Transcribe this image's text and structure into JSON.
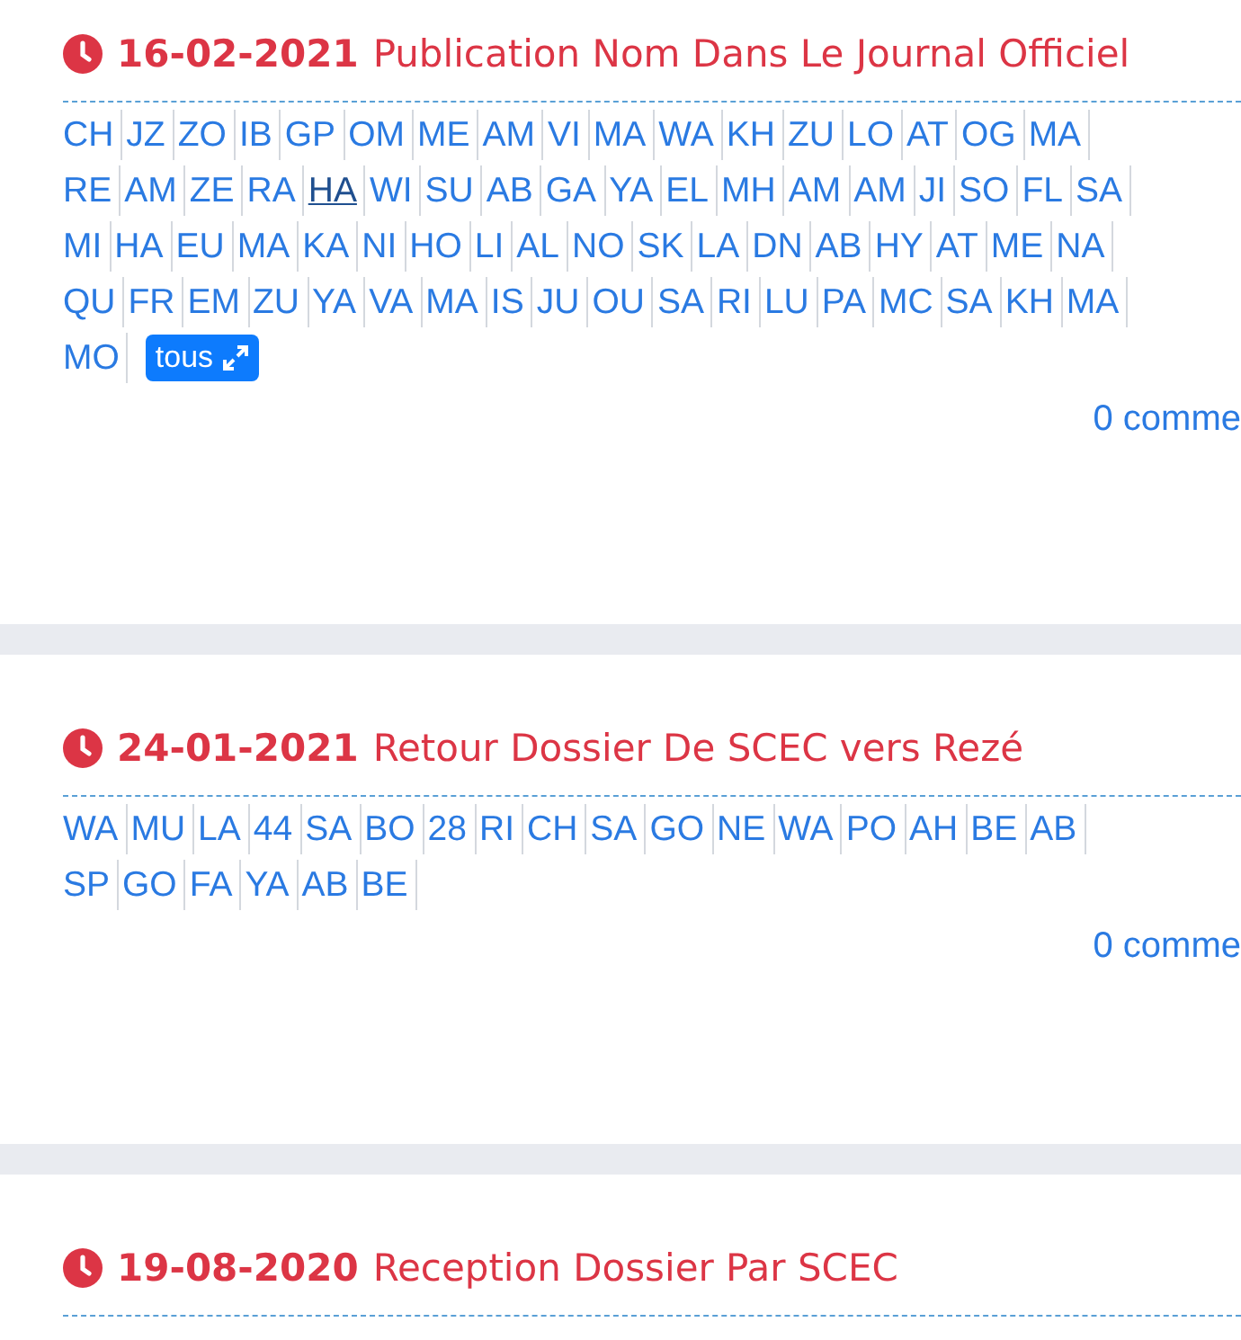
{
  "posts": [
    {
      "date": "16-02-2021",
      "title": "Publication Nom Dans Le Journal Officiel",
      "tag_rows": [
        [
          {
            "label": "CH",
            "selected": false
          },
          {
            "label": "JZ",
            "selected": false
          },
          {
            "label": "ZO",
            "selected": false
          },
          {
            "label": "IB",
            "selected": false
          },
          {
            "label": "GP",
            "selected": false
          },
          {
            "label": "OM",
            "selected": false
          },
          {
            "label": "ME",
            "selected": false
          },
          {
            "label": "AM",
            "selected": false
          },
          {
            "label": "VI",
            "selected": false
          },
          {
            "label": "MA",
            "selected": false
          },
          {
            "label": "WA",
            "selected": false
          },
          {
            "label": "KH",
            "selected": false
          },
          {
            "label": "ZU",
            "selected": false
          },
          {
            "label": "LO",
            "selected": false
          },
          {
            "label": "AT",
            "selected": false
          },
          {
            "label": "OG",
            "selected": false
          },
          {
            "label": "MA",
            "selected": false
          }
        ],
        [
          {
            "label": "RE",
            "selected": false
          },
          {
            "label": "AM",
            "selected": false
          },
          {
            "label": "ZE",
            "selected": false
          },
          {
            "label": "RA",
            "selected": false
          },
          {
            "label": "HA",
            "selected": true
          },
          {
            "label": "WI",
            "selected": false
          },
          {
            "label": "SU",
            "selected": false
          },
          {
            "label": "AB",
            "selected": false
          },
          {
            "label": "GA",
            "selected": false
          },
          {
            "label": "YA",
            "selected": false
          },
          {
            "label": "EL",
            "selected": false
          },
          {
            "label": "MH",
            "selected": false
          },
          {
            "label": "AM",
            "selected": false
          },
          {
            "label": "AM",
            "selected": false
          },
          {
            "label": "JI",
            "selected": false
          },
          {
            "label": "SO",
            "selected": false
          },
          {
            "label": "FL",
            "selected": false
          },
          {
            "label": "SA",
            "selected": false
          }
        ],
        [
          {
            "label": "MI",
            "selected": false
          },
          {
            "label": "HA",
            "selected": false
          },
          {
            "label": "EU",
            "selected": false
          },
          {
            "label": "MA",
            "selected": false
          },
          {
            "label": "KA",
            "selected": false
          },
          {
            "label": "NI",
            "selected": false
          },
          {
            "label": "HO",
            "selected": false
          },
          {
            "label": "LI",
            "selected": false
          },
          {
            "label": "AL",
            "selected": false
          },
          {
            "label": "NO",
            "selected": false
          },
          {
            "label": "SK",
            "selected": false
          },
          {
            "label": "LA",
            "selected": false
          },
          {
            "label": "DN",
            "selected": false
          },
          {
            "label": "AB",
            "selected": false
          },
          {
            "label": "HY",
            "selected": false
          },
          {
            "label": "AT",
            "selected": false
          },
          {
            "label": "ME",
            "selected": false
          },
          {
            "label": "NA",
            "selected": false
          }
        ],
        [
          {
            "label": "QU",
            "selected": false
          },
          {
            "label": "FR",
            "selected": false
          },
          {
            "label": "EM",
            "selected": false
          },
          {
            "label": "ZU",
            "selected": false
          },
          {
            "label": "YA",
            "selected": false
          },
          {
            "label": "VA",
            "selected": false
          },
          {
            "label": "MA",
            "selected": false
          },
          {
            "label": "IS",
            "selected": false
          },
          {
            "label": "JU",
            "selected": false
          },
          {
            "label": "OU",
            "selected": false
          },
          {
            "label": "SA",
            "selected": false
          },
          {
            "label": "RI",
            "selected": false
          },
          {
            "label": "LU",
            "selected": false
          },
          {
            "label": "PA",
            "selected": false
          },
          {
            "label": "MC",
            "selected": false
          },
          {
            "label": "SA",
            "selected": false
          },
          {
            "label": "KH",
            "selected": false
          },
          {
            "label": "MA",
            "selected": false
          }
        ],
        [
          {
            "label": "MO",
            "selected": false
          }
        ]
      ],
      "more_button": "tous",
      "comments": "0 comme"
    },
    {
      "date": "24-01-2021",
      "title": "Retour Dossier De SCEC vers Rezé",
      "tag_rows": [
        [
          {
            "label": "WA",
            "selected": false
          },
          {
            "label": "MU",
            "selected": false
          },
          {
            "label": "LA",
            "selected": false
          },
          {
            "label": "44",
            "selected": false
          },
          {
            "label": "SA",
            "selected": false
          },
          {
            "label": "BO",
            "selected": false
          },
          {
            "label": "28",
            "selected": false
          },
          {
            "label": "RI",
            "selected": false
          },
          {
            "label": "CH",
            "selected": false
          },
          {
            "label": "SA",
            "selected": false
          },
          {
            "label": "GO",
            "selected": false
          },
          {
            "label": "NE",
            "selected": false
          },
          {
            "label": "WA",
            "selected": false
          },
          {
            "label": "PO",
            "selected": false
          },
          {
            "label": "AH",
            "selected": false
          },
          {
            "label": "BE",
            "selected": false
          },
          {
            "label": "AB",
            "selected": false
          }
        ],
        [
          {
            "label": "SP",
            "selected": false
          },
          {
            "label": "GO",
            "selected": false
          },
          {
            "label": "FA",
            "selected": false
          },
          {
            "label": "YA",
            "selected": false
          },
          {
            "label": "AB",
            "selected": false
          },
          {
            "label": "BE",
            "selected": false
          }
        ]
      ],
      "comments": "0 comme"
    },
    {
      "date": "19-08-2020",
      "title": "Reception Dossier Par SCEC"
    }
  ]
}
